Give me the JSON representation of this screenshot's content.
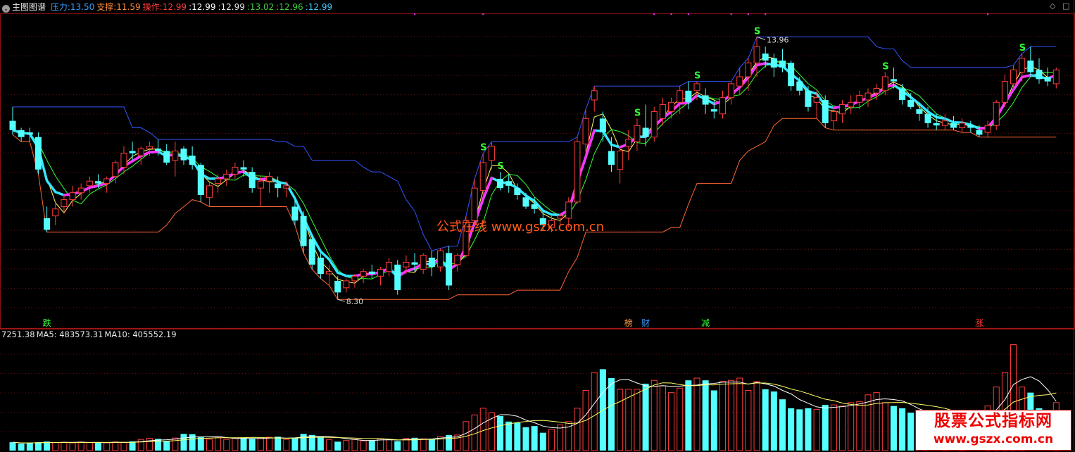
{
  "header": {
    "title": "主图图谱",
    "items": [
      {
        "label": "压力:",
        "value": "13.50",
        "color": "#3aa0ff"
      },
      {
        "label": "支撑:",
        "value": "11.59",
        "color": "#ff8a3c"
      },
      {
        "label": "操作:",
        "value": "12.99",
        "color": "#ff3b3b"
      },
      {
        "label": ":",
        "value": "12.99",
        "color": "#ffffff"
      },
      {
        "label": ":",
        "value": "12.99",
        "color": "#e6e6e6"
      },
      {
        "label": ":",
        "value": "13.02",
        "color": "#40d040"
      },
      {
        "label": ":",
        "value": "12.96",
        "color": "#40d040"
      },
      {
        "label": ":",
        "value": "12.99",
        "color": "#40c8ff"
      }
    ]
  },
  "volume_header": {
    "items": [
      {
        "label": "",
        "value": "7251.38"
      },
      {
        "label": "MA5:",
        "value": "483573.31"
      },
      {
        "label": "MA10:",
        "value": "405552.19"
      }
    ]
  },
  "watermark": {
    "line1": "股票公式指标网",
    "line2": "www.gszx.com.cn"
  },
  "mid_watermark": "公式在线 www.gszx.com.cn",
  "chart_data": {
    "type": "candlestick",
    "price_range": [
      8.0,
      14.3
    ],
    "max_label": "13.96",
    "min_label": "8.30",
    "ohlc": [
      [
        12.15,
        12.45,
        11.85,
        11.95
      ],
      [
        11.95,
        12.0,
        11.7,
        11.8
      ],
      [
        11.9,
        12.0,
        11.7,
        11.85
      ],
      [
        11.8,
        11.9,
        11.0,
        11.1
      ],
      [
        10.05,
        10.3,
        9.75,
        9.8
      ],
      [
        10.1,
        10.4,
        9.9,
        10.25
      ],
      [
        10.3,
        10.55,
        10.15,
        10.45
      ],
      [
        10.45,
        10.75,
        10.3,
        10.6
      ],
      [
        10.6,
        10.8,
        10.45,
        10.7
      ],
      [
        10.75,
        10.95,
        10.6,
        10.85
      ],
      [
        10.85,
        11.0,
        10.7,
        10.8
      ],
      [
        10.8,
        10.95,
        10.6,
        10.9
      ],
      [
        10.95,
        11.3,
        10.8,
        11.25
      ],
      [
        11.15,
        11.6,
        11.0,
        11.45
      ],
      [
        11.5,
        11.7,
        11.3,
        11.45
      ],
      [
        11.4,
        11.6,
        11.2,
        11.55
      ],
      [
        11.55,
        11.7,
        11.4,
        11.6
      ],
      [
        11.55,
        11.75,
        11.4,
        11.5
      ],
      [
        11.5,
        11.65,
        11.2,
        11.25
      ],
      [
        11.3,
        11.7,
        10.95,
        11.5
      ],
      [
        11.55,
        11.6,
        11.2,
        11.3
      ],
      [
        11.4,
        11.6,
        11.1,
        11.2
      ],
      [
        11.2,
        11.25,
        10.4,
        10.55
      ],
      [
        10.5,
        10.85,
        10.3,
        10.75
      ],
      [
        10.8,
        11.0,
        10.6,
        10.9
      ],
      [
        10.9,
        11.1,
        10.75,
        11.0
      ],
      [
        11.0,
        11.25,
        10.9,
        11.15
      ],
      [
        11.15,
        11.3,
        10.95,
        11.1
      ],
      [
        11.05,
        11.15,
        10.6,
        10.7
      ],
      [
        10.7,
        10.95,
        10.3,
        10.85
      ],
      [
        10.85,
        11.05,
        10.6,
        10.95
      ],
      [
        10.8,
        10.95,
        10.5,
        10.7
      ],
      [
        10.7,
        10.85,
        10.5,
        10.75
      ],
      [
        10.3,
        10.45,
        9.9,
        10.0
      ],
      [
        10.1,
        10.2,
        9.3,
        9.45
      ],
      [
        9.6,
        9.7,
        8.95,
        9.05
      ],
      [
        9.2,
        9.3,
        8.75,
        8.85
      ],
      [
        8.85,
        9.05,
        8.6,
        8.9
      ],
      [
        8.7,
        8.8,
        8.3,
        8.45
      ],
      [
        8.55,
        8.75,
        8.45,
        8.7
      ],
      [
        8.7,
        8.85,
        8.55,
        8.8
      ],
      [
        8.8,
        8.95,
        8.65,
        8.9
      ],
      [
        8.9,
        9.05,
        8.75,
        8.85
      ],
      [
        8.8,
        9.0,
        8.6,
        8.95
      ],
      [
        8.9,
        9.2,
        8.8,
        9.1
      ],
      [
        9.05,
        9.15,
        8.4,
        8.5
      ],
      [
        9.0,
        9.25,
        8.85,
        9.1
      ],
      [
        9.1,
        9.3,
        8.9,
        9.05
      ],
      [
        8.95,
        9.3,
        8.85,
        9.25
      ],
      [
        9.2,
        9.35,
        8.8,
        9.0
      ],
      [
        9.0,
        9.4,
        8.9,
        9.35
      ],
      [
        9.3,
        9.45,
        8.5,
        8.6
      ],
      [
        9.05,
        9.3,
        8.9,
        9.25
      ],
      [
        9.25,
        10.1,
        9.2,
        10.0
      ],
      [
        10.0,
        10.9,
        9.9,
        10.7
      ],
      [
        10.65,
        11.45,
        10.5,
        11.25
      ],
      [
        11.3,
        11.7,
        11.1,
        11.6
      ],
      [
        10.9,
        11.05,
        10.65,
        10.7
      ],
      [
        10.85,
        11.0,
        10.6,
        10.75
      ],
      [
        10.7,
        10.8,
        10.45,
        10.55
      ],
      [
        10.5,
        10.6,
        10.25,
        10.3
      ],
      [
        10.35,
        10.5,
        10.15,
        10.25
      ],
      [
        10.05,
        10.2,
        9.8,
        9.9
      ],
      [
        9.85,
        10.1,
        9.75,
        10.0
      ],
      [
        10.05,
        10.15,
        9.85,
        10.1
      ],
      [
        10.05,
        10.5,
        9.85,
        10.4
      ],
      [
        10.4,
        11.8,
        10.35,
        11.7
      ],
      [
        11.65,
        12.4,
        11.4,
        12.2
      ],
      [
        12.6,
        12.9,
        12.35,
        12.8
      ],
      [
        12.2,
        12.35,
        11.7,
        11.9
      ],
      [
        11.5,
        11.8,
        11.05,
        11.2
      ],
      [
        11.1,
        11.6,
        10.8,
        11.5
      ],
      [
        11.6,
        11.95,
        11.3,
        11.75
      ],
      [
        11.7,
        12.2,
        11.5,
        12.05
      ],
      [
        12.0,
        12.5,
        11.6,
        11.8
      ],
      [
        11.8,
        12.45,
        11.7,
        12.35
      ],
      [
        12.2,
        12.65,
        12.05,
        12.5
      ],
      [
        12.35,
        12.65,
        12.2,
        12.55
      ],
      [
        12.55,
        12.9,
        12.3,
        12.8
      ],
      [
        12.8,
        13.0,
        12.4,
        12.55
      ],
      [
        12.8,
        13.0,
        12.6,
        12.95
      ],
      [
        12.7,
        12.85,
        12.3,
        12.5
      ],
      [
        12.4,
        12.6,
        12.2,
        12.35
      ],
      [
        12.3,
        12.8,
        12.2,
        12.65
      ],
      [
        12.65,
        13.0,
        12.5,
        12.95
      ],
      [
        12.9,
        13.3,
        12.7,
        13.1
      ],
      [
        13.1,
        13.5,
        12.8,
        13.4
      ],
      [
        13.4,
        13.96,
        13.1,
        13.75
      ],
      [
        13.6,
        13.75,
        13.3,
        13.45
      ],
      [
        13.5,
        13.6,
        13.1,
        13.3
      ],
      [
        13.45,
        13.7,
        13.2,
        13.3
      ],
      [
        13.4,
        13.45,
        12.8,
        12.9
      ],
      [
        13.0,
        13.1,
        12.7,
        12.8
      ],
      [
        12.8,
        12.9,
        12.35,
        12.45
      ],
      [
        12.55,
        12.8,
        12.2,
        12.65
      ],
      [
        12.6,
        12.7,
        12.0,
        12.1
      ],
      [
        12.15,
        12.45,
        11.95,
        12.35
      ],
      [
        12.3,
        12.6,
        12.1,
        12.5
      ],
      [
        12.45,
        12.7,
        12.3,
        12.55
      ],
      [
        12.55,
        12.8,
        12.4,
        12.7
      ],
      [
        12.6,
        12.85,
        12.45,
        12.75
      ],
      [
        12.75,
        12.95,
        12.6,
        12.85
      ],
      [
        12.8,
        13.2,
        12.7,
        13.1
      ],
      [
        13.05,
        13.3,
        12.85,
        13.0
      ],
      [
        12.85,
        12.95,
        12.5,
        12.6
      ],
      [
        12.6,
        12.75,
        12.4,
        12.45
      ],
      [
        12.4,
        12.55,
        12.15,
        12.3
      ],
      [
        12.3,
        12.45,
        12.0,
        12.1
      ],
      [
        12.1,
        12.3,
        11.95,
        12.05
      ],
      [
        12.05,
        12.3,
        11.95,
        12.15
      ],
      [
        12.1,
        12.25,
        11.95,
        12.0
      ],
      [
        12.0,
        12.2,
        11.9,
        12.1
      ],
      [
        12.05,
        12.15,
        11.9,
        12.0
      ],
      [
        11.95,
        12.05,
        11.8,
        11.85
      ],
      [
        11.9,
        12.15,
        11.8,
        12.05
      ],
      [
        12.05,
        12.6,
        11.95,
        12.55
      ],
      [
        12.55,
        13.15,
        12.45,
        13.0
      ],
      [
        12.95,
        13.35,
        12.8,
        13.25
      ],
      [
        13.2,
        13.6,
        13.0,
        13.5
      ],
      [
        13.45,
        13.75,
        13.1,
        13.2
      ],
      [
        13.25,
        13.5,
        12.95,
        13.05
      ],
      [
        13.1,
        13.3,
        12.9,
        13.0
      ],
      [
        12.95,
        13.3,
        12.85,
        13.25
      ]
    ],
    "volume": [
      60000,
      50000,
      55000,
      60000,
      65000,
      58000,
      60000,
      55000,
      62000,
      58000,
      60000,
      55000,
      62000,
      58000,
      66000,
      80000,
      88000,
      84000,
      70000,
      90000,
      120000,
      118000,
      96000,
      82000,
      92000,
      80000,
      88000,
      92000,
      84000,
      88000,
      96000,
      100000,
      80000,
      92000,
      120000,
      112000,
      100000,
      80000,
      64000,
      72000,
      80000,
      70000,
      76000,
      84000,
      80000,
      68000,
      88000,
      92000,
      84000,
      84000,
      100000,
      112000,
      112000,
      208000,
      256000,
      304000,
      272000,
      248000,
      208000,
      200000,
      168000,
      176000,
      128000,
      152000,
      184000,
      208000,
      304000,
      432000,
      560000,
      584000,
      520000,
      440000,
      440000,
      440000,
      480000,
      504000,
      464000,
      416000,
      448000,
      504000,
      520000,
      504000,
      432000,
      496000,
      504000,
      520000,
      432000,
      496000,
      440000,
      424000,
      368000,
      304000,
      296000,
      304000,
      296000,
      328000,
      328000,
      320000,
      344000,
      352000,
      400000,
      416000,
      344000,
      320000,
      304000,
      272000,
      256000,
      240000,
      248000,
      232000,
      216000,
      200000,
      216000,
      272000,
      320000,
      456000,
      560000,
      760000,
      456000,
      416000,
      304000,
      248000,
      344000
    ],
    "ma_volume": {
      "MA5": "483573.31",
      "MA10": "405552.19"
    },
    "signal_labels": [
      "跌",
      "榜",
      "财",
      "减",
      "涨"
    ],
    "sell_marks": [
      "S",
      "S",
      "S",
      "S",
      "S",
      "S",
      "S"
    ],
    "series_colors": {
      "ma_thick": "#ff33ff",
      "ma_cyan": "#33e6ff",
      "upper_band": "#3355ff",
      "lower_band": "#ff6633",
      "thin_green": "#33ff33",
      "thin_yellow": "#ffff66"
    }
  }
}
